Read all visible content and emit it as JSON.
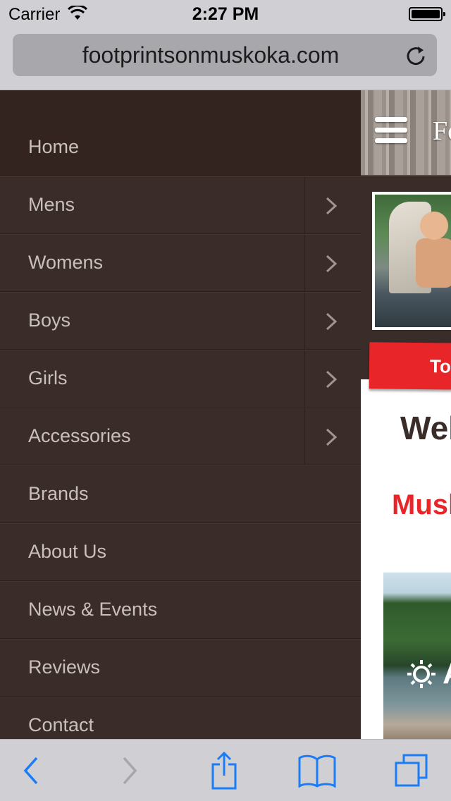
{
  "status_bar": {
    "carrier": "Carrier",
    "time": "2:27 PM",
    "battery_level": 1.0,
    "icons": [
      "wifi-icon",
      "battery-icon"
    ]
  },
  "browser": {
    "url": "footprintsonmuskoka.com",
    "icons": [
      "reload-icon"
    ]
  },
  "menu": {
    "items": [
      {
        "label": "Home",
        "has_submenu": false,
        "active": true
      },
      {
        "label": "Mens",
        "has_submenu": true
      },
      {
        "label": "Womens",
        "has_submenu": true
      },
      {
        "label": "Boys",
        "has_submenu": true
      },
      {
        "label": "Girls",
        "has_submenu": true
      },
      {
        "label": "Accessories",
        "has_submenu": true
      },
      {
        "label": "Brands",
        "has_submenu": false
      },
      {
        "label": "About Us",
        "has_submenu": false
      },
      {
        "label": "News & Events",
        "has_submenu": false
      },
      {
        "label": "Reviews",
        "has_submenu": false
      },
      {
        "label": "Contact",
        "has_submenu": false
      }
    ],
    "icons": [
      "chevron-right-icon"
    ]
  },
  "site": {
    "logo_text": "Fo",
    "red_tab_text": "To",
    "welcome_text": "Wel",
    "muskoka_text": "Musk",
    "lake_letter": "A",
    "icons": [
      "hamburger-icon",
      "sun-icon"
    ]
  },
  "toolbar": {
    "icons": [
      "back-icon",
      "forward-icon",
      "share-icon",
      "bookmarks-icon",
      "tabs-icon"
    ]
  },
  "colors": {
    "menu_bg": "#3a2c28",
    "menu_text": "#c9c0bb",
    "accent_red": "#e8262a",
    "ios_blue": "#1a7cf6",
    "chrome_gray": "#d0cfd4"
  }
}
